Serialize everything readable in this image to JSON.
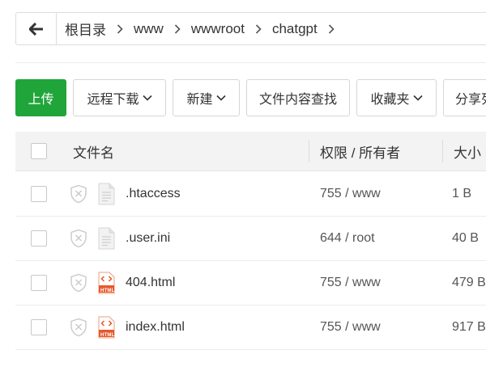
{
  "breadcrumb": {
    "items": [
      "根目录",
      "www",
      "wwwroot",
      "chatgpt"
    ]
  },
  "toolbar": {
    "upload": "上传",
    "remote_download": "远程下载",
    "new": "新建",
    "content_search": "文件内容查找",
    "favorites": "收藏夹",
    "share_list": "分享列"
  },
  "table": {
    "headers": {
      "name": "文件名",
      "permission": "权限 / 所有者",
      "size": "大小"
    },
    "rows": [
      {
        "name": ".htaccess",
        "permission": "755 / www",
        "size": "1 B",
        "icon": "text-file-icon"
      },
      {
        "name": ".user.ini",
        "permission": "644 / root",
        "size": "40 B",
        "icon": "text-file-icon"
      },
      {
        "name": "404.html",
        "permission": "755 / www",
        "size": "479 B",
        "icon": "html-file-icon"
      },
      {
        "name": "index.html",
        "permission": "755 / www",
        "size": "917 B",
        "icon": "html-file-icon"
      }
    ]
  },
  "html_badge": "HTML",
  "colors": {
    "primary": "#20a53a",
    "html_icon": "#e8572b"
  }
}
